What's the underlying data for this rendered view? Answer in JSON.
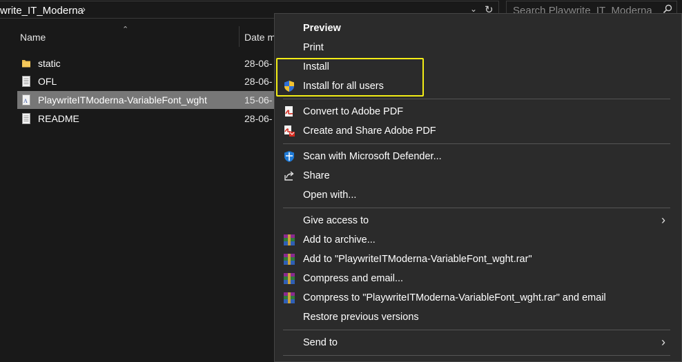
{
  "address_bar": {
    "path_text": "write_IT_Moderna",
    "chevron": "›",
    "dropdown_icon": "chevron-down-icon",
    "refresh_icon": "refresh-icon"
  },
  "search": {
    "placeholder": "Search Playwrite_IT_Moderna",
    "icon": "search-icon"
  },
  "file_list": {
    "columns": {
      "name": "Name",
      "date": "Date m"
    },
    "rows": [
      {
        "name": "static",
        "date": "28-06-",
        "icon": "folder-icon"
      },
      {
        "name": "OFL",
        "date": "28-06-",
        "icon": "text-file-icon"
      },
      {
        "name": "PlaywriteITModerna-VariableFont_wght",
        "date": "15-06-",
        "icon": "font-file-icon",
        "selected": true
      },
      {
        "name": "README",
        "date": "28-06-",
        "icon": "text-file-icon"
      }
    ]
  },
  "context_menu": {
    "items": [
      {
        "label": "Preview",
        "bold": true
      },
      {
        "label": "Print"
      },
      {
        "label": "Install"
      },
      {
        "label": "Install for all users",
        "icon": "uac-shield-icon"
      },
      {
        "label": "Convert to Adobe PDF",
        "icon": "adobe-pdf-icon"
      },
      {
        "label": "Create and Share Adobe PDF",
        "icon": "adobe-share-icon"
      },
      {
        "label": "Scan with Microsoft Defender...",
        "icon": "defender-shield-icon"
      },
      {
        "label": "Share",
        "icon": "share-icon"
      },
      {
        "label": "Open with..."
      },
      {
        "label": "Give access to",
        "submenu": true
      },
      {
        "label": "Add to archive...",
        "icon": "winrar-icon"
      },
      {
        "label": "Add to \"PlaywriteITModerna-VariableFont_wght.rar\"",
        "icon": "winrar-icon"
      },
      {
        "label": "Compress and email...",
        "icon": "winrar-icon"
      },
      {
        "label": "Compress to \"PlaywriteITModerna-VariableFont_wght.rar\" and email",
        "icon": "winrar-icon"
      },
      {
        "label": "Restore previous versions"
      },
      {
        "label": "Send to",
        "submenu": true
      }
    ],
    "submenu_arrow": "›"
  },
  "colors": {
    "background": "#191919",
    "menu_background": "#2b2b2b",
    "highlight_border": "#f4ee16",
    "selected_row": "#777777"
  }
}
